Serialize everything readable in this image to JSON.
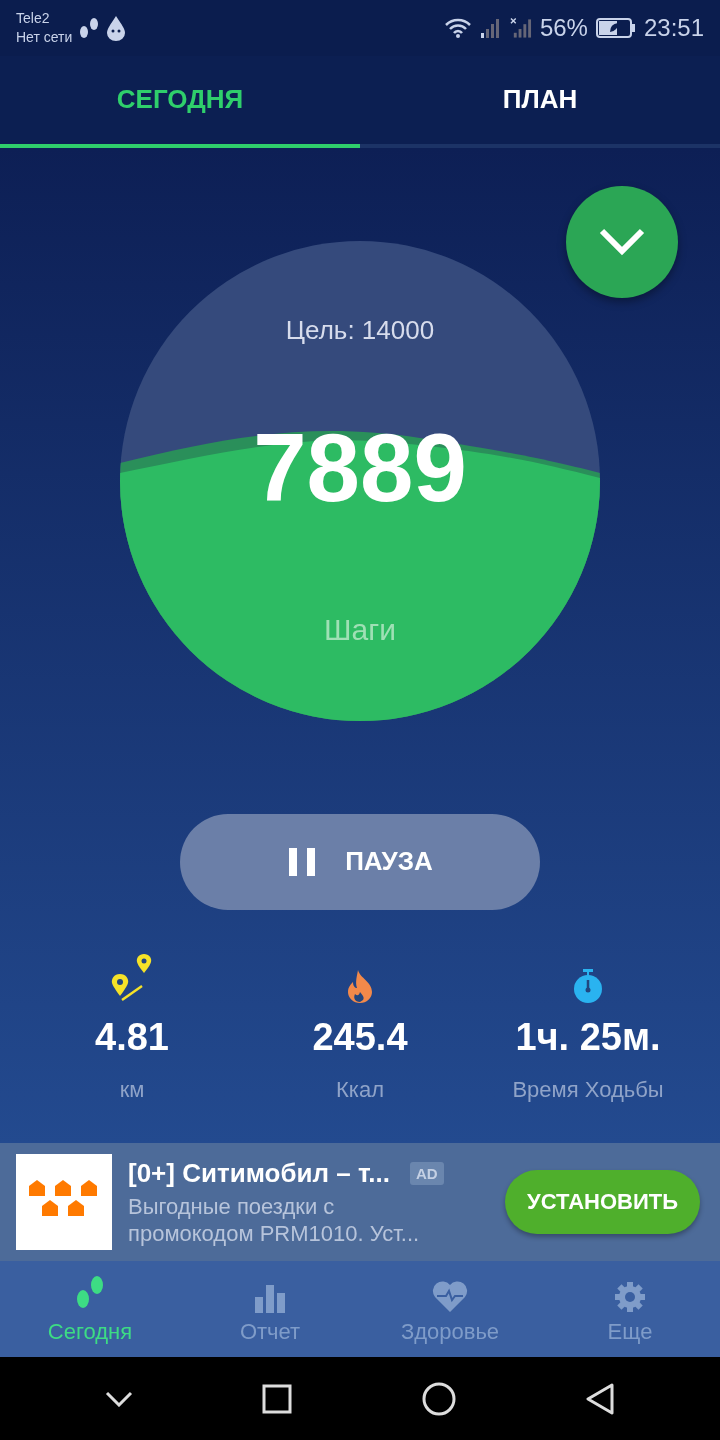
{
  "status_bar": {
    "carrier": "Tele2",
    "network": "Нет сети",
    "battery": "56%",
    "time": "23:51"
  },
  "tabs": [
    {
      "label": "СЕГОДНЯ",
      "selected": true
    },
    {
      "label": "ПЛАН",
      "selected": false
    }
  ],
  "progress": {
    "goal": "Цель: 14000",
    "steps": "7889",
    "label": "Шаги"
  },
  "pause_button": "ПАУЗА",
  "stats": [
    {
      "kind": "distance",
      "value": "4.81",
      "unit": "км"
    },
    {
      "kind": "calories",
      "value": "245.4",
      "unit": "Ккал"
    },
    {
      "kind": "time",
      "value": "1ч. 25м.",
      "unit": "Время Ходьбы"
    }
  ],
  "ad": {
    "title": "[0+] Ситимобил – т...",
    "badge": "AD",
    "text": "Выгодные поездки с промокодом PRM1010. Уст...",
    "button": "УСТАНОВИТЬ"
  },
  "bottom_nav": [
    {
      "kind": "today",
      "label": "Сегодня",
      "selected": true
    },
    {
      "kind": "report",
      "label": "Отчет",
      "selected": false
    },
    {
      "kind": "health",
      "label": "Здоровье",
      "selected": false
    },
    {
      "kind": "more",
      "label": "Еще",
      "selected": false
    }
  ]
}
